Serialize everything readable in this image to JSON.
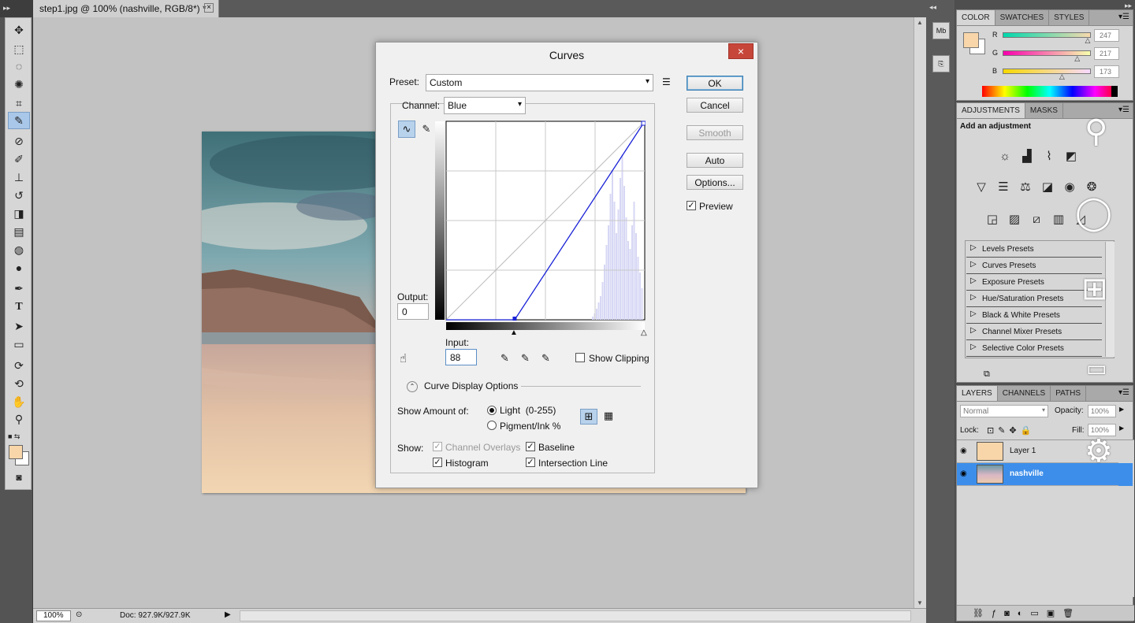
{
  "app": {
    "doc_tab_title": "step1.jpg @ 100% (nashville, RGB/8*) *",
    "doc_tab_close": "×",
    "zoom": "100%",
    "doc_size": "Doc: 927.9K/927.9K"
  },
  "colors": {
    "foreground": "#f9d6a9",
    "selection": "#3d8eea",
    "dialog_close": "#c7463a"
  },
  "tools": [
    "move-tool-icon",
    "marquee-tool-icon",
    "lasso-tool-icon",
    "quick-select-tool-icon",
    "crop-tool-icon",
    "eyedropper-tool-icon",
    "healing-brush-tool-icon",
    "brush-tool-icon",
    "clone-stamp-tool-icon",
    "history-brush-tool-icon",
    "eraser-tool-icon",
    "gradient-tool-icon",
    "blur-tool-icon",
    "dodge-tool-icon",
    "pen-tool-icon",
    "type-tool-icon",
    "path-select-tool-icon",
    "shape-tool-icon",
    "3d-rotate-tool-icon",
    "3d-orbit-tool-icon",
    "hand-tool-icon",
    "zoom-tool-icon"
  ],
  "color_panel": {
    "tabs": [
      "COLOR",
      "SWATCHES",
      "STYLES"
    ],
    "r_label": "R",
    "g_label": "G",
    "b_label": "B",
    "r": "247",
    "g": "217",
    "b": "173",
    "r_level": 0.969,
    "g_level": 0.851,
    "b_level": 0.678
  },
  "adjustments_panel": {
    "tabs": [
      "ADJUSTMENTS",
      "MASKS"
    ],
    "heading": "Add an adjustment",
    "presets": [
      "Levels Presets",
      "Curves Presets",
      "Exposure Presets",
      "Hue/Saturation Presets",
      "Black & White Presets",
      "Channel Mixer Presets",
      "Selective Color Presets"
    ]
  },
  "layers_panel": {
    "tabs": [
      "LAYERS",
      "CHANNELS",
      "PATHS"
    ],
    "blend_mode": "Normal",
    "opacity_label": "Opacity:",
    "opacity": "100%",
    "lock_label": "Lock:",
    "fill_label": "Fill:",
    "fill": "100%",
    "layers": [
      {
        "name": "Layer 1",
        "selected": false
      },
      {
        "name": "nashville",
        "selected": true
      }
    ]
  },
  "curves_dialog": {
    "title": "Curves",
    "close": "×",
    "preset_label": "Preset:",
    "preset_value": "Custom",
    "channel_label": "Channel:",
    "channel_value": "Blue",
    "output_label": "Output:",
    "output_value": "0",
    "input_label": "Input:",
    "input_value": "88",
    "buttons": {
      "ok": "OK",
      "cancel": "Cancel",
      "smooth": "Smooth",
      "auto": "Auto",
      "options": "Options..."
    },
    "preview_label": "Preview",
    "preview_checked": true,
    "show_clipping_label": "Show Clipping",
    "display_options_label": "Curve Display Options",
    "show_amount_label": "Show Amount of:",
    "light_label": "Light  (0-255)",
    "pigment_label": "Pigment/Ink %",
    "show_label": "Show:",
    "channel_overlays_label": "Channel Overlays",
    "baseline_label": "Baseline",
    "histogram_label": "Histogram",
    "intersection_label": "Intersection Line",
    "curve_points": [
      [
        88,
        0
      ],
      [
        255,
        255
      ]
    ]
  }
}
